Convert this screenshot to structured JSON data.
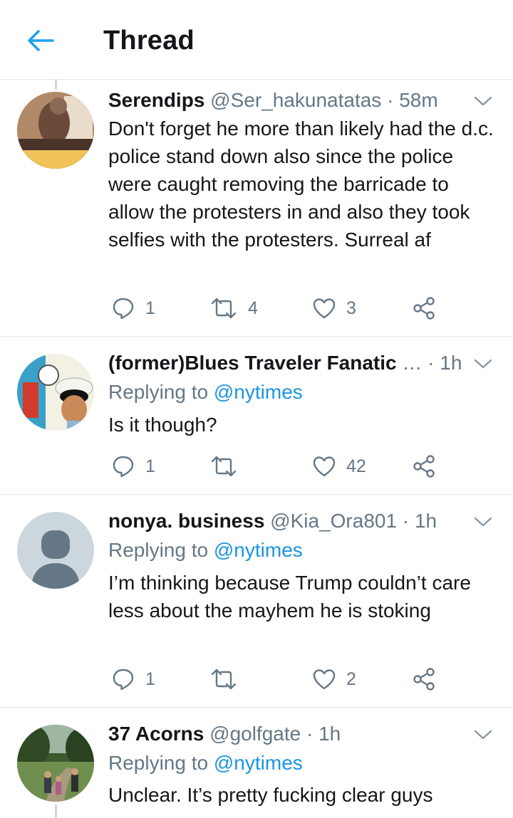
{
  "header": {
    "title": "Thread",
    "back_icon": "arrow-left-icon",
    "accent": "#1da1f2"
  },
  "tweets": [
    {
      "name": "Serendips",
      "handle": "@Ser_hakunatatas",
      "time": "58m",
      "replying_prefix": "",
      "replying_to": "",
      "text": "Don't forget he more than likely had the d.c. police stand down also since the police were caught removing the barricade to allow the protesters in and also they took selfies with the protesters. Surreal af",
      "replies": "1",
      "retweets": "4",
      "likes": "3"
    },
    {
      "name": "(former)Blues Traveler Fanatic",
      "handle": "…",
      "time": "1h",
      "replying_prefix": "Replying to",
      "replying_to": "@nytimes",
      "text": "Is it though?",
      "replies": "1",
      "retweets": "",
      "likes": "42"
    },
    {
      "name": "nonya. business",
      "handle": "@Kia_Ora801",
      "time": "1h",
      "replying_prefix": "Replying to",
      "replying_to": "@nytimes",
      "text": "I’m thinking because Trump couldn’t care less about the mayhem he is stoking",
      "replies": "1",
      "retweets": "",
      "likes": "2"
    },
    {
      "name": "37 Acorns",
      "handle": "@golfgate",
      "time": "1h",
      "replying_prefix": "Replying to",
      "replying_to": "@nytimes",
      "text": "Unclear.  It’s pretty fucking clear guys"
    }
  ],
  "icons": {
    "reply": "reply-icon",
    "retweet": "retweet-icon",
    "like": "heart-icon",
    "share": "share-icon",
    "caret": "chevron-down-icon"
  },
  "colors": {
    "text": "#14171a",
    "muted": "#657786",
    "link": "#1b95e0",
    "divider": "#e1e8ed"
  }
}
